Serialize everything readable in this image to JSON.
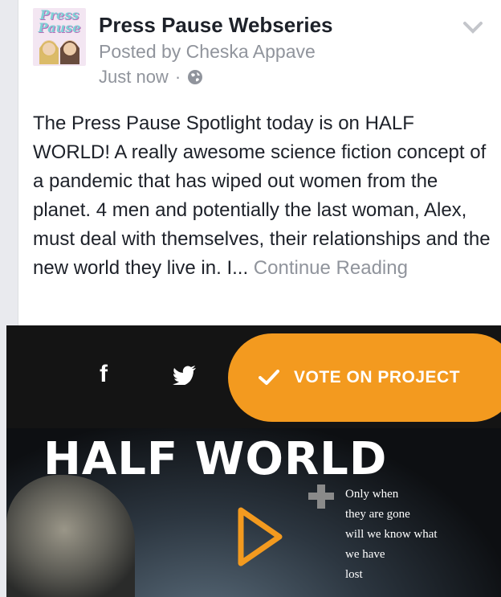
{
  "post": {
    "page_name": "Press Pause Webseries",
    "posted_by": "Posted by Cheska Appave",
    "timestamp": "Just now",
    "separator": "·",
    "privacy_icon": "globe-icon",
    "avatar_logo": "Press Pause",
    "body": "The Press Pause Spotlight today is on HALF WORLD! A really awesome science fiction concept of a pandemic that has wiped out women from the planet. 4 men and potentially the last woman, Alex, must deal with themselves, their relationships and the new world they live in. I...",
    "continue_label": "Continue Reading"
  },
  "media": {
    "facebook_icon": "facebook-icon",
    "twitter_icon": "twitter-icon",
    "vote_label": "VOTE ON PROJECT",
    "film_title": "HALF WORLD",
    "tagline": [
      "Only when",
      "they are gone",
      "will we know what",
      "we have",
      "lost"
    ]
  },
  "colors": {
    "accent_orange": "#f39a1f",
    "muted_text": "#90949c",
    "body_text": "#1d2129"
  }
}
